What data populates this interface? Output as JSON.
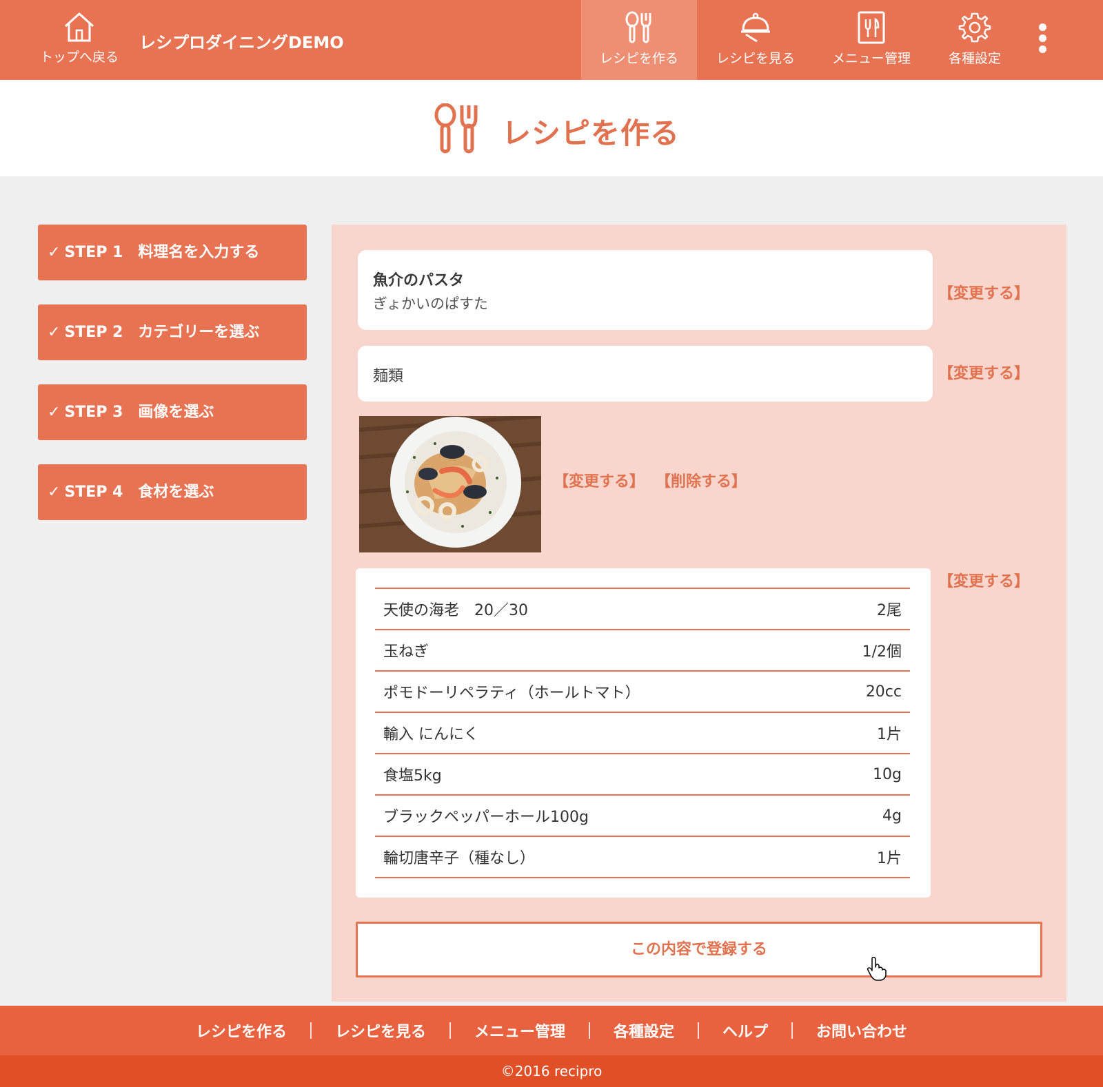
{
  "header": {
    "home_label": "トップへ戻る",
    "app_title": "レシプロダイニングDEMO",
    "nav": [
      {
        "label": "レシピを作る",
        "icon": "spoon-fork-icon",
        "active": true
      },
      {
        "label": "レシピを見る",
        "icon": "cloche-icon",
        "active": false
      },
      {
        "label": "メニュー管理",
        "icon": "menu-book-icon",
        "active": false
      },
      {
        "label": "各種設定",
        "icon": "gear-icon",
        "active": false
      }
    ]
  },
  "page_title": "レシピを作る",
  "steps": [
    {
      "label": "STEP 1　料理名を入力する"
    },
    {
      "label": "STEP 2　カテゴリーを選ぶ"
    },
    {
      "label": "STEP 3　画像を選ぶ"
    },
    {
      "label": "STEP 4　食材を選ぶ"
    }
  ],
  "recipe": {
    "name": "魚介のパスタ",
    "kana": "ぎょかいのぱすた",
    "category": "麺類",
    "change_label": "【変更する】",
    "delete_label": "【削除する】",
    "ingredients": [
      {
        "name": "天使の海老　20／30",
        "qty": "2尾"
      },
      {
        "name": "玉ねぎ",
        "qty": "1/2個"
      },
      {
        "name": "ポモドーリペラティ（ホールトマト）",
        "qty": "20cc"
      },
      {
        "name": "輸入 にんにく",
        "qty": "1片"
      },
      {
        "name": "食塩5kg",
        "qty": "10g"
      },
      {
        "name": "ブラックペッパーホール100g",
        "qty": "4g"
      },
      {
        "name": "輪切唐辛子（種なし）",
        "qty": "1片"
      }
    ]
  },
  "submit_label": "この内容で登録する",
  "footer": {
    "links": [
      "レシピを作る",
      "レシピを見る",
      "メニュー管理",
      "各種設定",
      "ヘルプ",
      "お問い合わせ"
    ],
    "copyright": "©2016 recipro"
  },
  "colors": {
    "accent": "#e87353",
    "panel": "#f8d5cd",
    "footer": "#e8623f",
    "footer_bottom": "#e04f25"
  }
}
